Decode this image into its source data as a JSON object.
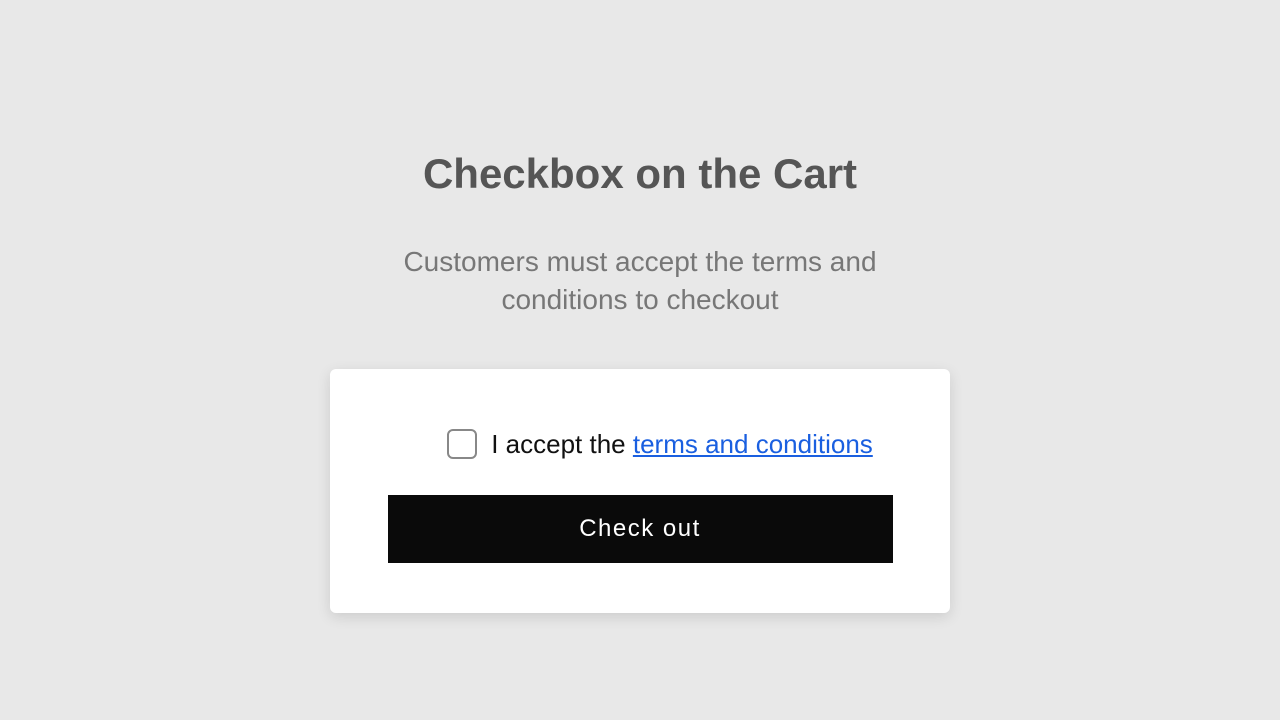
{
  "header": {
    "title": "Checkbox on the Cart",
    "subtitle": "Customers must accept the terms and conditions to checkout"
  },
  "card": {
    "accept_prefix": "I accept the ",
    "terms_link_text": "terms and conditions",
    "checkout_label": "Check out"
  }
}
